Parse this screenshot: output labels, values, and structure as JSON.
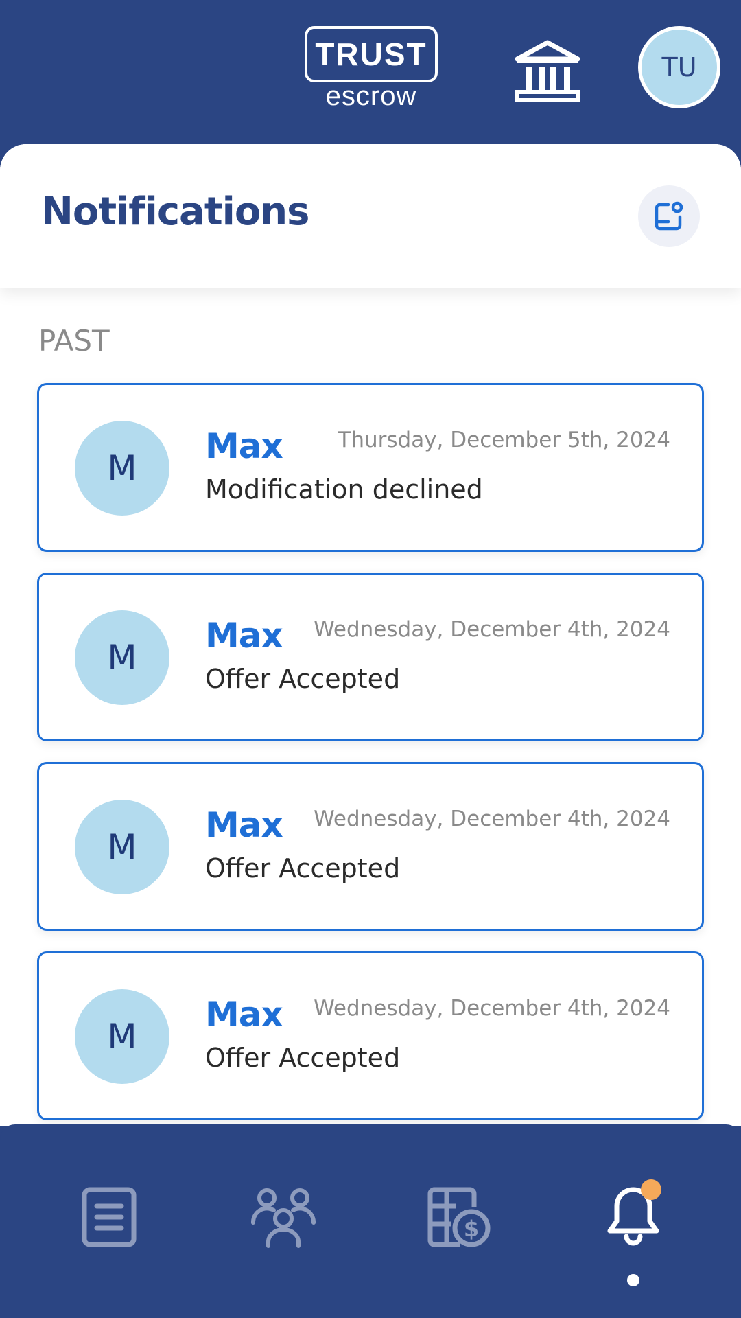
{
  "header": {
    "logo_main": "TRUST",
    "logo_sub": "escrow",
    "bank_icon": "bank-icon",
    "user_initials": "TU"
  },
  "page": {
    "title": "Notifications",
    "action_icon": "mark-read-icon"
  },
  "section": {
    "label": "PAST"
  },
  "notifications": [
    {
      "initial": "M",
      "sender": "Max",
      "date": "Thursday, December 5th, 2024",
      "message": "Modification declined"
    },
    {
      "initial": "M",
      "sender": "Max",
      "date": "Wednesday, December 4th, 2024",
      "message": "Offer Accepted"
    },
    {
      "initial": "M",
      "sender": "Max",
      "date": "Wednesday, December 4th, 2024",
      "message": "Offer Accepted"
    },
    {
      "initial": "M",
      "sender": "Max",
      "date": "Wednesday, December 4th, 2024",
      "message": "Offer Accepted"
    }
  ],
  "nav": {
    "items": [
      {
        "icon": "document-list-icon",
        "active": false
      },
      {
        "icon": "people-icon",
        "active": false
      },
      {
        "icon": "payments-icon",
        "active": false
      },
      {
        "icon": "bell-icon",
        "active": true,
        "has_badge": true
      }
    ]
  },
  "colors": {
    "brand_navy": "#2b4583",
    "accent_blue": "#1f6fd6",
    "avatar_bg": "#b3dbee",
    "badge_orange": "#f5a95a",
    "inactive_icon": "#8d9bbd"
  }
}
